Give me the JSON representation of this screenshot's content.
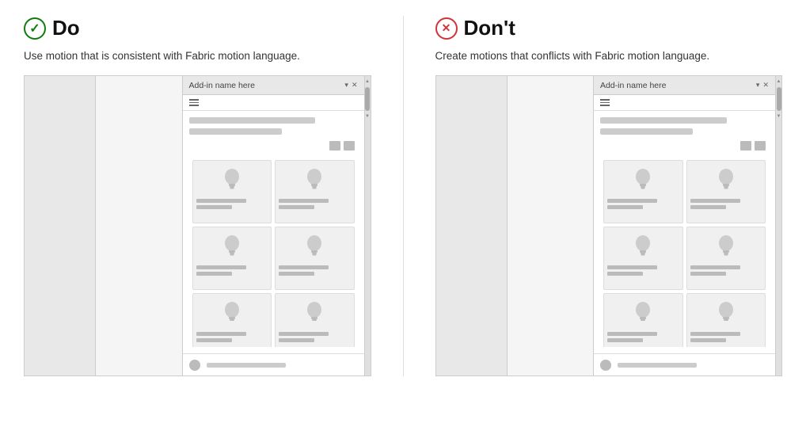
{
  "do_section": {
    "heading": "Do",
    "description": "Use motion that is consistent with Fabric motion language.",
    "window": {
      "taskpane_title": "Add-in name here",
      "hamburger": true,
      "content_bars": [
        "long",
        "medium"
      ],
      "items": [
        {},
        {},
        {},
        {},
        {},
        {}
      ]
    }
  },
  "dont_section": {
    "heading": "Don't",
    "description": "Create motions that conflicts with Fabric motion language.",
    "window": {
      "taskpane_title": "Add-in name here",
      "hamburger": true,
      "content_bars": [
        "long",
        "medium"
      ],
      "items": [
        {},
        {},
        {},
        {},
        {},
        {}
      ]
    }
  },
  "icons": {
    "check": "✓",
    "x": "✕",
    "chevron_up": "▲",
    "chevron_down": "▼",
    "pin": "▾",
    "close": "✕",
    "list_view": "≡",
    "grid_view": "⊞"
  }
}
